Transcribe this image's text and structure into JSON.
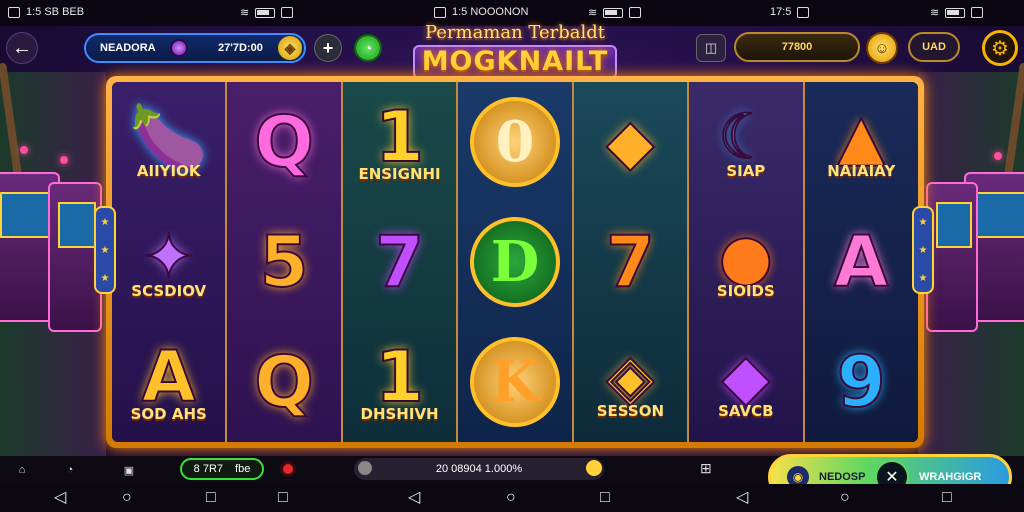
{
  "status": {
    "left_time": "1:5 SB BEB",
    "mid_time": "1:5 NOOONON",
    "right_time": "17:5"
  },
  "header": {
    "account_name": "NEADORA",
    "balance": "27'7D:00",
    "coin_glyph": "◈",
    "plus_glyph": "+",
    "green_glyph": "◔",
    "title_top": "Permaman Terbaldt",
    "title_main": "MOGKNAILT",
    "square_btn_glyph": "◫",
    "credit": "77800",
    "avatar_glyph": "☺",
    "currency": "UAD",
    "settings_glyph": "⚙"
  },
  "reels": [
    [
      {
        "sym": "🍆",
        "label": "AIIYIOK",
        "color": "#3aa8ff"
      },
      {
        "sym": "✦",
        "label": "SCSDIOV",
        "color": "#c070ff"
      },
      {
        "sym": "A",
        "label": "SOD AHS",
        "color": "#ffc02a"
      }
    ],
    [
      {
        "sym": "Q",
        "label": "",
        "color": "#ff6ae0"
      },
      {
        "sym": "5",
        "label": "",
        "color": "#ffb02a"
      },
      {
        "sym": "Q",
        "label": "",
        "color": "#ffb02a"
      }
    ],
    [
      {
        "sym": "1",
        "label": "ENSIGNHI",
        "color": "#ffd02a"
      },
      {
        "sym": "7",
        "label": "",
        "color": "#c050ff"
      },
      {
        "sym": "1",
        "label": "DHSHIVH",
        "color": "#ffd02a"
      }
    ],
    [
      {
        "sym": "0",
        "label": "",
        "color": "#fff2c0"
      },
      {
        "sym": "D",
        "label": "",
        "color": "#7aff3a"
      },
      {
        "sym": "K",
        "label": "",
        "color": "#ffa02a"
      }
    ],
    [
      {
        "sym": "◆",
        "label": "",
        "color": "#ffb02a"
      },
      {
        "sym": "7",
        "label": "",
        "color": "#ff8a1a"
      },
      {
        "sym": "◈",
        "label": "SESSON",
        "color": "#ffc02a"
      }
    ],
    [
      {
        "sym": "☾",
        "label": "SIAP",
        "color": "#4aa8ff"
      },
      {
        "sym": "●",
        "label": "SIOIDS",
        "color": "#ff7a1a"
      },
      {
        "sym": "◆",
        "label": "SAVCB",
        "color": "#c050ff"
      }
    ],
    [
      {
        "sym": "▲",
        "label": "NAIAIAY",
        "color": "#ff8a1a"
      },
      {
        "sym": "A",
        "label": "",
        "color": "#ff7ad5"
      },
      {
        "sym": "9",
        "label": "",
        "color": "#2ab0ff"
      }
    ]
  ],
  "bottom": {
    "bet_a": "8 7R7",
    "bet_b": "fbe",
    "win_text": "20 08904 1.000%",
    "spin_left_label": "NEDOSP",
    "spin_right_label": "WRAHGIGR",
    "spin_glyph": "✕",
    "left_icon_glyph": "◉"
  },
  "nav": {
    "back": "◁",
    "home": "○",
    "recents": "□"
  },
  "colors": {
    "frame": "#d47a00",
    "accent_gold": "#ffd23a",
    "spin_green": "#5fd85f"
  }
}
